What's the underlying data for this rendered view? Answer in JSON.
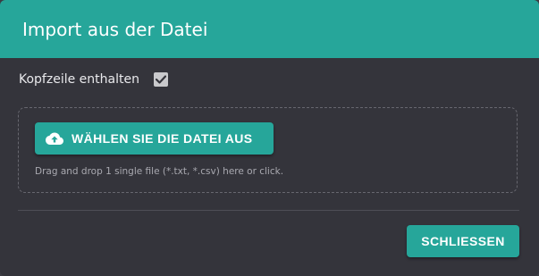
{
  "dialog": {
    "title": "Import aus der Datei"
  },
  "options": {
    "header_label": "Kopfzeile enthalten",
    "header_checked": true
  },
  "dropzone": {
    "button_label": "WÄHLEN SIE DIE DATEI AUS",
    "button_icon": "cloud-upload-icon",
    "hint": "Drag and drop 1 single file (*.txt, *.csv) here or click."
  },
  "footer": {
    "close_label": "SCHLIESSEN"
  },
  "colors": {
    "accent": "#26a69a",
    "dialog_bg": "#34343b",
    "text": "#e9e9ec",
    "muted_text": "#a9a9b0"
  }
}
